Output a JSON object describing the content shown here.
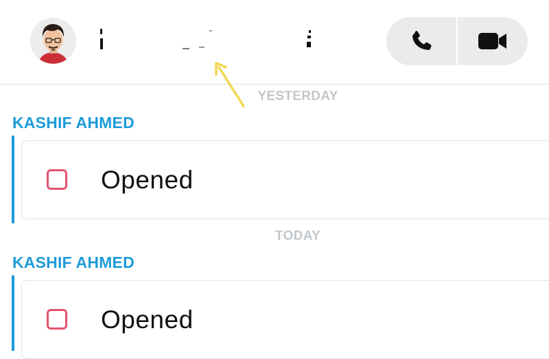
{
  "header": {
    "phone_icon": "phone-icon",
    "video_icon": "video-camera-icon",
    "accent": "#ebebee"
  },
  "annotation": {
    "arrow_color": "#f2d652"
  },
  "sections": [
    {
      "date_label": "YESTERDAY",
      "sender": "KASHIF AHMED",
      "status_icon": "opened-snap-icon",
      "status_text": "Opened"
    },
    {
      "date_label": "TODAY",
      "sender": "KASHIF AHMED",
      "status_icon": "opened-snap-icon",
      "status_text": "Opened"
    }
  ],
  "colors": {
    "sender": "#1e9bd8",
    "snap_outline": "#e4526b",
    "date_label": "#c2c7cc"
  }
}
